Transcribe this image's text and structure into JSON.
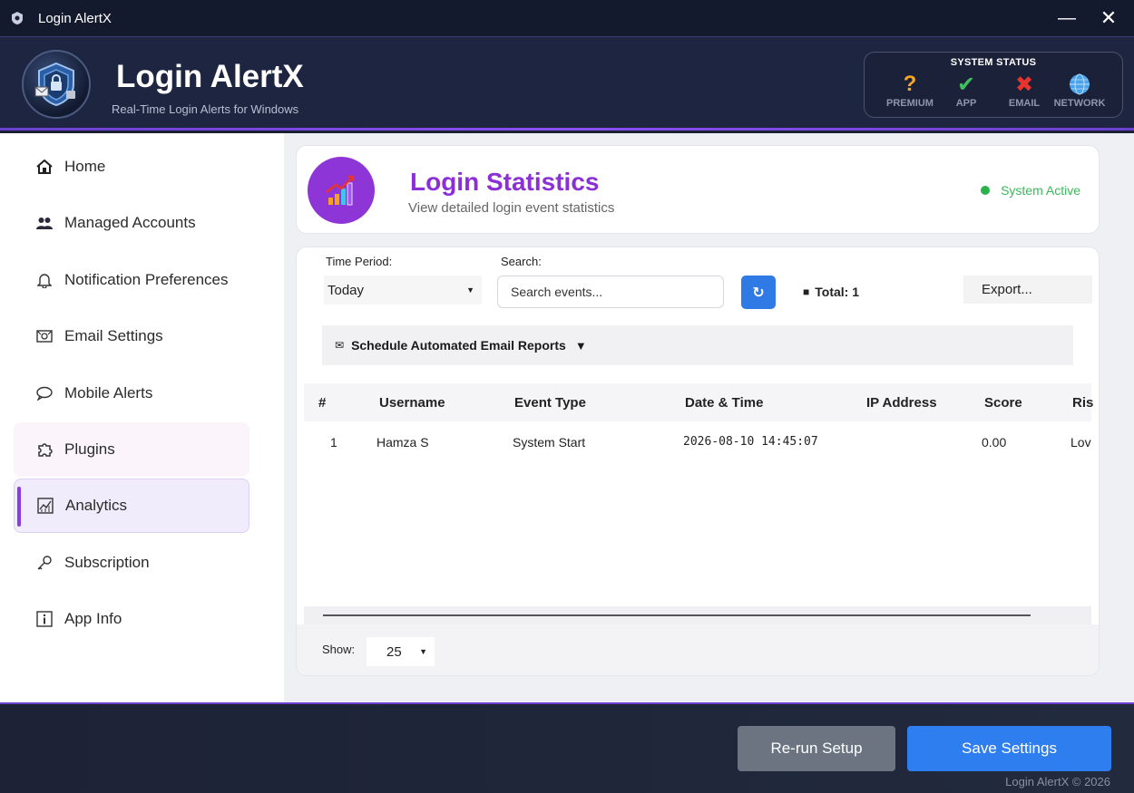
{
  "window": {
    "title": "Login AlertX",
    "minimize": "—",
    "close": "✕"
  },
  "header": {
    "app_name": "Login AlertX",
    "tagline": "Real-Time Login Alerts for Windows",
    "system_status": {
      "title": "SYSTEM STATUS",
      "items": [
        {
          "label": "PREMIUM",
          "glyph": "?",
          "color": "#f5a623",
          "icon": "question-icon"
        },
        {
          "label": "APP",
          "glyph": "✔",
          "color": "#3fbf5f",
          "icon": "check-icon"
        },
        {
          "label": "EMAIL",
          "glyph": "✖",
          "color": "#e8342f",
          "icon": "cross-icon"
        },
        {
          "label": "NETWORK",
          "glyph": "",
          "color": "#4aa3e8",
          "icon": "globe-icon"
        }
      ]
    }
  },
  "sidebar": {
    "items": [
      {
        "label": "Home",
        "icon": "home-icon"
      },
      {
        "label": "Managed Accounts",
        "icon": "users-icon"
      },
      {
        "label": "Notification Preferences",
        "icon": "bell-icon"
      },
      {
        "label": "Email Settings",
        "icon": "email-icon"
      },
      {
        "label": "Mobile Alerts",
        "icon": "chat-bubble-icon"
      },
      {
        "label": "Plugins",
        "icon": "puzzle-icon"
      },
      {
        "label": "Analytics",
        "icon": "chart-icon"
      },
      {
        "label": "Subscription",
        "icon": "key-icon"
      },
      {
        "label": "App Info",
        "icon": "info-icon"
      }
    ],
    "active": "Analytics"
  },
  "page": {
    "title": "Login Statistics",
    "subtitle": "View detailed login event statistics",
    "status": "System Active"
  },
  "filters": {
    "time_period_label": "Time Period:",
    "time_period_value": "Today",
    "search_label": "Search:",
    "search_placeholder": "Search events...",
    "refresh": "↻",
    "total": "Total: 1",
    "export": "Export..."
  },
  "schedule": {
    "label": "Schedule Automated Email Reports",
    "toggle": "▼"
  },
  "table": {
    "columns": [
      "#",
      "Username",
      "Event Type",
      "Date & Time",
      "IP Address",
      "Score",
      "Ris"
    ],
    "rows": [
      [
        "1",
        "Hamza S",
        "System Start",
        "2026-08-10 14:45:07",
        "",
        "0.00",
        "Lov"
      ]
    ]
  },
  "pagination": {
    "show_label": "Show:",
    "page_size": "25"
  },
  "footer": {
    "rerun": "Re-run Setup",
    "save": "Save Settings",
    "copyright": "Login AlertX © 2026"
  },
  "colors": {
    "accent": "#8b2fd6",
    "primary_button": "#2f7ef0",
    "active_status": "#2bb24c"
  }
}
